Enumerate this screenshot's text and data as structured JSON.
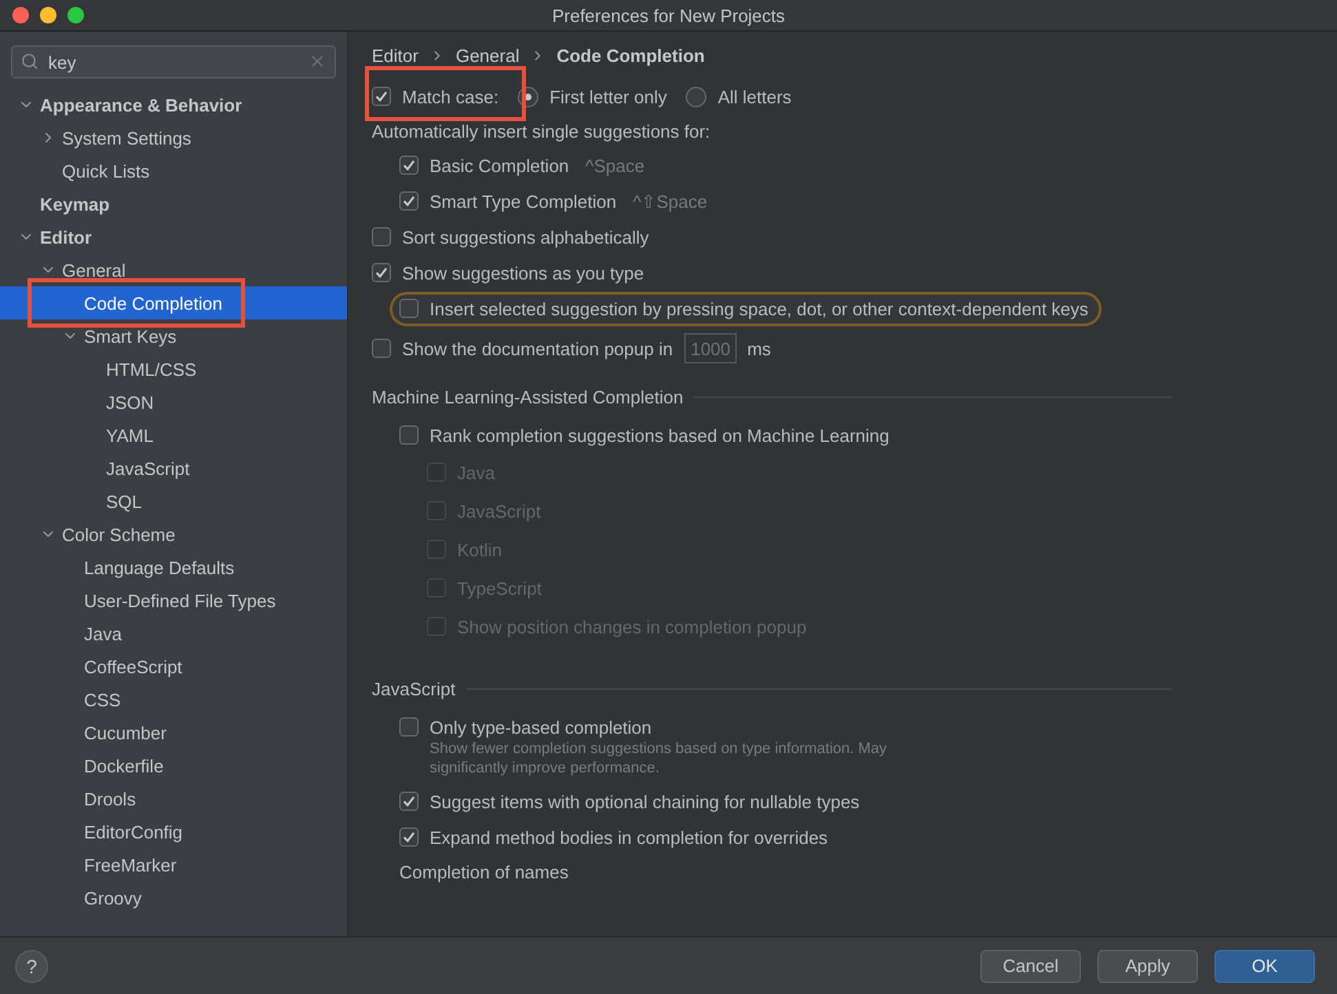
{
  "window": {
    "title": "Preferences for New Projects"
  },
  "sidebar": {
    "search": {
      "value": "key"
    },
    "tree": [
      {
        "label": "Appearance & Behavior",
        "expanded": true,
        "selected": false,
        "children": [
          {
            "label": "System Settings",
            "expanded": false,
            "selected": false
          },
          {
            "label": "Quick Lists",
            "selected": false
          }
        ]
      },
      {
        "label": "Keymap",
        "selected": false
      },
      {
        "label": "Editor",
        "expanded": true,
        "selected": false,
        "children": [
          {
            "label": "General",
            "expanded": true,
            "selected": false,
            "children": [
              {
                "label": "Code Completion",
                "selected": true,
                "annotated": true
              },
              {
                "label": "Smart Keys",
                "expanded": true,
                "selected": false,
                "children": [
                  {
                    "label": "HTML/CSS",
                    "selected": false
                  },
                  {
                    "label": "JSON",
                    "selected": false
                  },
                  {
                    "label": "YAML",
                    "selected": false
                  },
                  {
                    "label": "JavaScript",
                    "selected": false
                  },
                  {
                    "label": "SQL",
                    "selected": false
                  }
                ]
              }
            ]
          },
          {
            "label": "Color Scheme",
            "expanded": true,
            "selected": false,
            "children": [
              {
                "label": "Language Defaults",
                "selected": false
              },
              {
                "label": "User-Defined File Types",
                "selected": false
              },
              {
                "label": "Java",
                "selected": false
              },
              {
                "label": "CoffeeScript",
                "selected": false
              },
              {
                "label": "CSS",
                "selected": false
              },
              {
                "label": "Cucumber",
                "selected": false
              },
              {
                "label": "Dockerfile",
                "selected": false
              },
              {
                "label": "Drools",
                "selected": false
              },
              {
                "label": "EditorConfig",
                "selected": false
              },
              {
                "label": "FreeMarker",
                "selected": false
              },
              {
                "label": "Groovy",
                "selected": false
              }
            ]
          }
        ]
      }
    ]
  },
  "breadcrumb": [
    "Editor",
    "General",
    "Code Completion"
  ],
  "settings": [
    {
      "kind": "checkbox_radios",
      "label": "Match case:",
      "checked": true,
      "annotated": true,
      "options": [
        {
          "label": "First letter only",
          "selected": true
        },
        {
          "label": "All letters",
          "selected": false
        }
      ]
    },
    {
      "kind": "label",
      "label": "Automatically insert single suggestions for:",
      "children": [
        {
          "kind": "checkbox",
          "label": "Basic Completion",
          "checked": true,
          "shortcut": "^Space"
        },
        {
          "kind": "checkbox",
          "label": "Smart Type Completion",
          "checked": true,
          "shortcut": "^⇧Space"
        }
      ]
    },
    {
      "kind": "checkbox",
      "label": "Sort suggestions alphabetically",
      "checked": false
    },
    {
      "kind": "checkbox",
      "label": "Show suggestions as you type",
      "checked": true,
      "children": [
        {
          "kind": "checkbox",
          "label": "Insert selected suggestion by pressing space, dot, or other context-dependent keys",
          "checked": false,
          "focused": true
        }
      ]
    },
    {
      "kind": "number_field",
      "label": "Show the documentation popup in",
      "checked": false,
      "value": "1000",
      "unit": "ms"
    },
    {
      "kind": "section",
      "label": "Machine Learning-Assisted Completion",
      "children": [
        {
          "kind": "checkbox",
          "label": "Rank completion suggestions based on Machine Learning",
          "checked": false,
          "children": [
            {
              "kind": "checkbox",
              "label": "Java",
              "checked": false,
              "disabled": true
            },
            {
              "kind": "checkbox",
              "label": "JavaScript",
              "checked": false,
              "disabled": true
            },
            {
              "kind": "checkbox",
              "label": "Kotlin",
              "checked": false,
              "disabled": true
            },
            {
              "kind": "checkbox",
              "label": "TypeScript",
              "checked": false,
              "disabled": true
            },
            {
              "kind": "checkbox",
              "label": "Show position changes in completion popup",
              "checked": false,
              "disabled": true
            }
          ]
        }
      ]
    },
    {
      "kind": "section",
      "label": "JavaScript",
      "children": [
        {
          "kind": "checkbox",
          "label": "Only type-based completion",
          "checked": false,
          "note": "Show fewer completion suggestions based on type information. May significantly improve performance."
        },
        {
          "kind": "checkbox",
          "label": "Suggest items with optional chaining for nullable types",
          "checked": true
        },
        {
          "kind": "checkbox",
          "label": "Expand method bodies in completion for overrides",
          "checked": true
        },
        {
          "kind": "label",
          "label": "Completion of names"
        }
      ]
    }
  ],
  "footer": {
    "help": "?",
    "buttons": [
      {
        "label": "Cancel",
        "default": false
      },
      {
        "label": "Apply",
        "default": false
      },
      {
        "label": "OK",
        "default": true
      }
    ]
  }
}
